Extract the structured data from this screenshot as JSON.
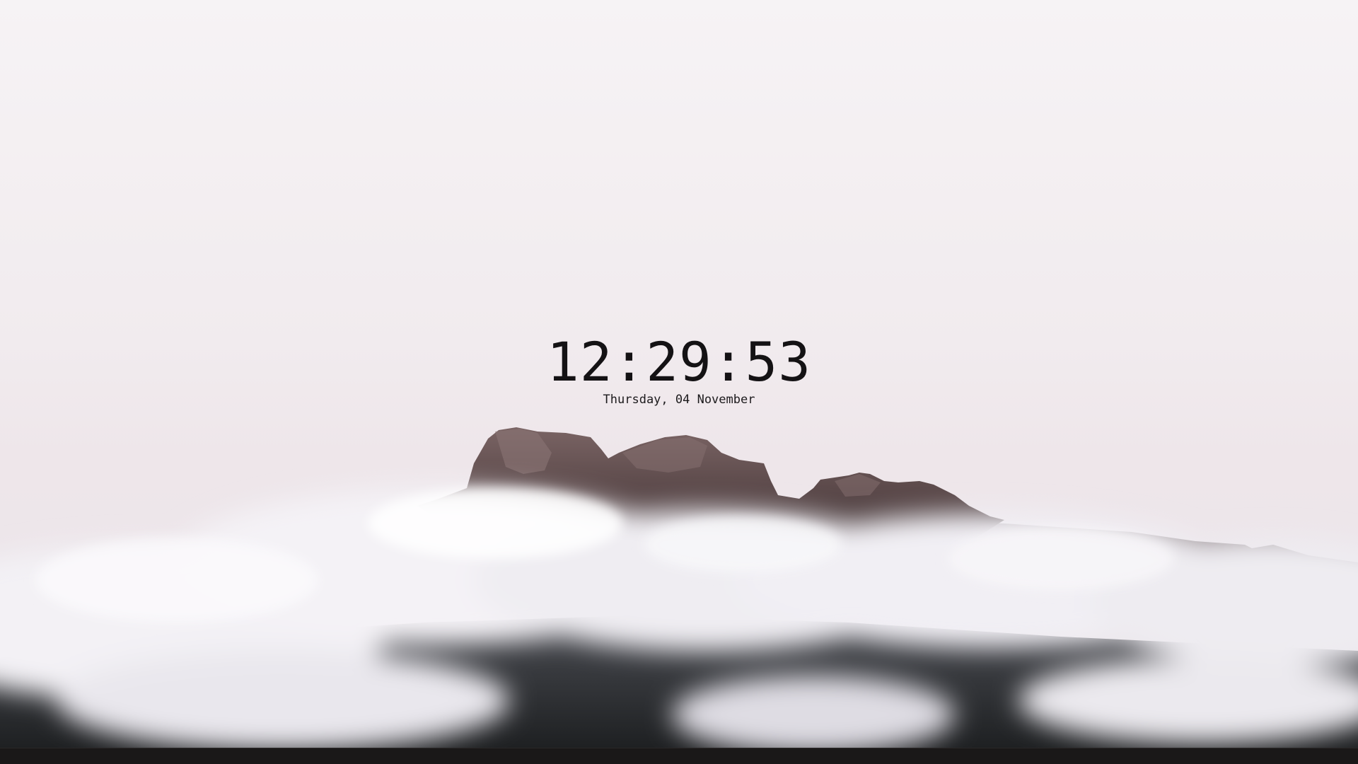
{
  "desktop": {
    "clock": {
      "time": "12:29:53",
      "date": "Thursday, 04 November"
    },
    "wallpaper": {
      "subject": "",
      "colors": {
        "sky": "#f3eff1",
        "rock": "#5b4a4b",
        "cloud": "#f2f0f4",
        "forest": "#2a2b2d"
      }
    },
    "taskbar": {
      "color": "#1a1818"
    }
  }
}
